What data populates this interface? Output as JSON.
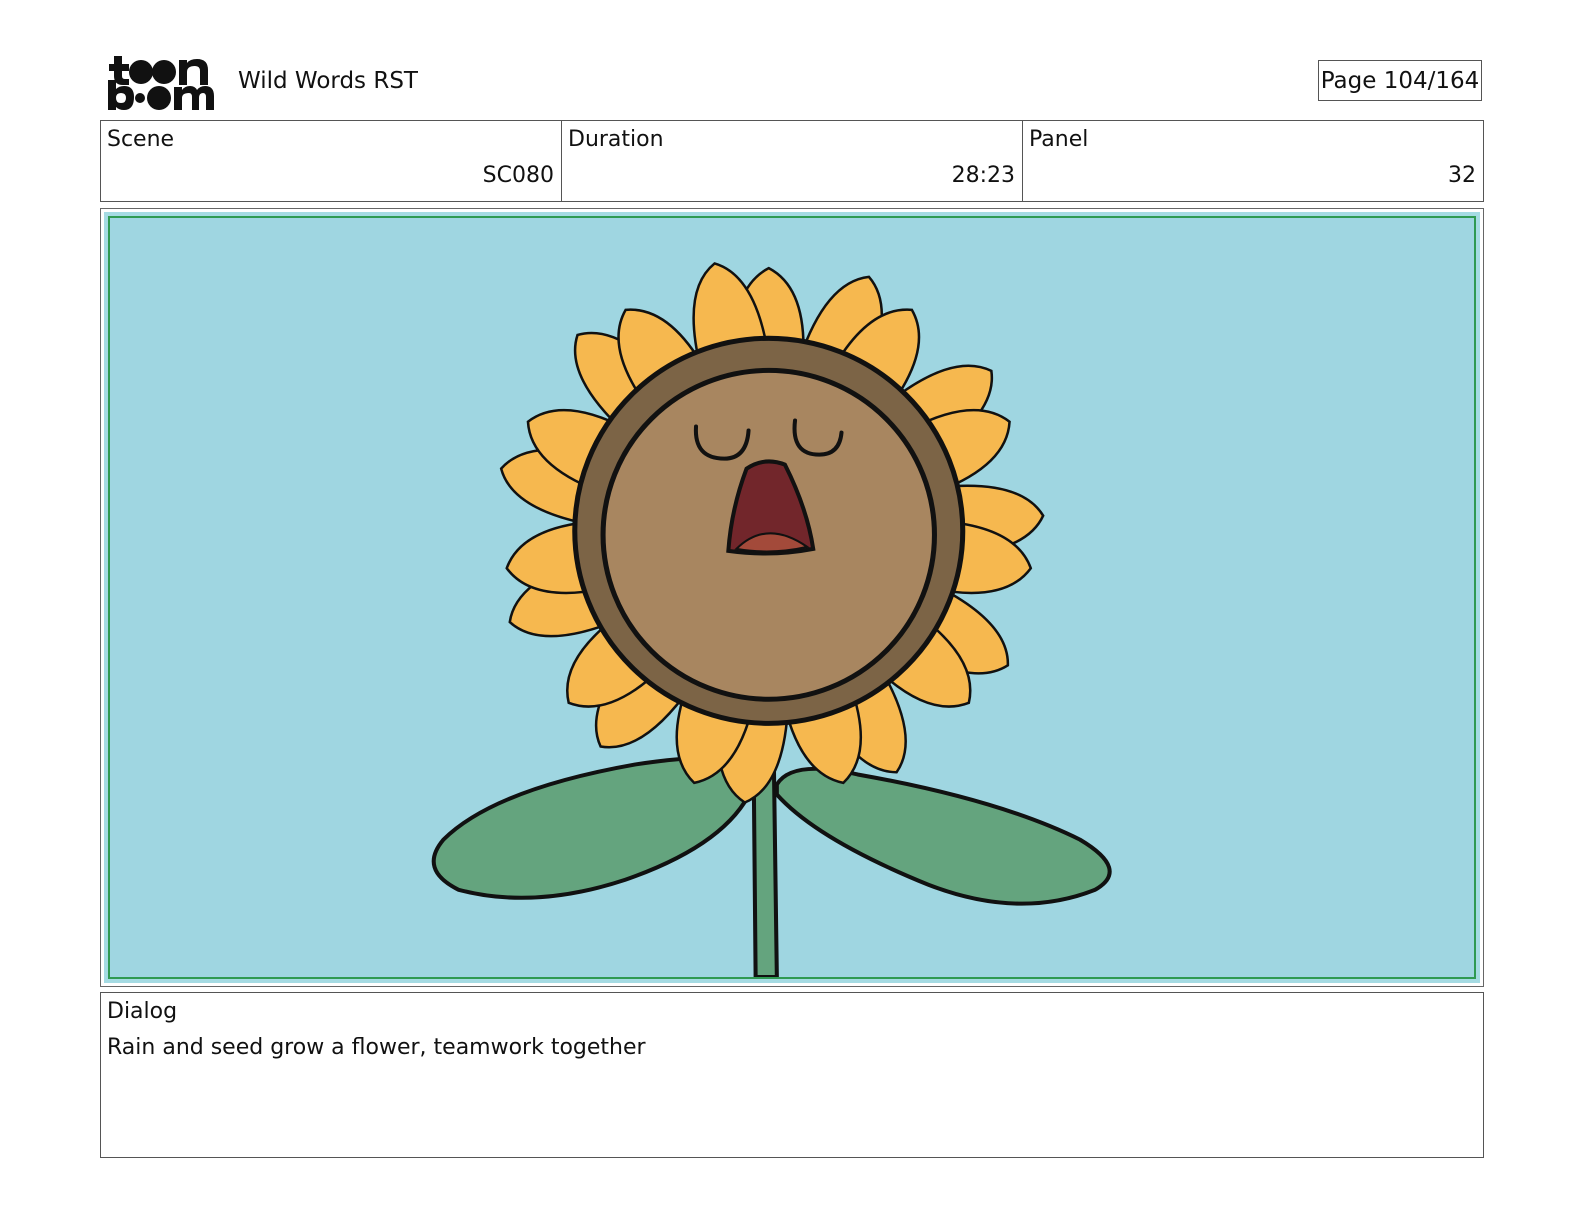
{
  "header": {
    "logo_text": "toon boom",
    "project_title": "Wild Words RST",
    "page_label": "Page 104/164"
  },
  "info": {
    "scene_label": "Scene",
    "scene_value": "SC080",
    "duration_label": "Duration",
    "duration_value": "28:23",
    "panel_label": "Panel",
    "panel_value": "32"
  },
  "panel_image": {
    "subject": "singing-sunflower",
    "colors": {
      "sky": "#9fd6e1",
      "frame": "#2f9a52",
      "petals": "#f6b84f",
      "face_ring": "#7c6446",
      "face": "#a88660",
      "mouth": "#72262b",
      "tongue": "#a34a3a",
      "leaves": "#64a47e",
      "stem": "#64a47e"
    }
  },
  "dialog": {
    "label": "Dialog",
    "text": "Rain and seed grow a flower, teamwork together"
  }
}
